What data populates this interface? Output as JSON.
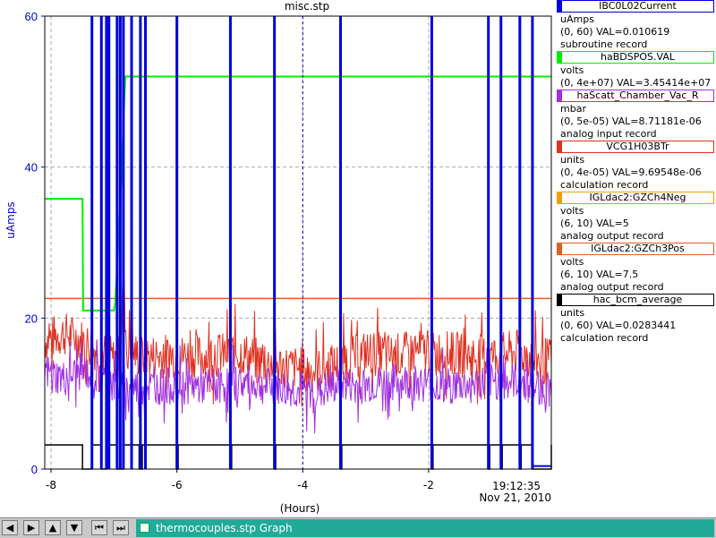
{
  "chart_data": {
    "type": "line",
    "title": "misc.stp",
    "xlabel": "(Hours)",
    "ylabel": "uAmps",
    "xlim": [
      -8.1,
      -0.05
    ],
    "ylim": [
      0,
      60
    ],
    "x_ticks": [
      -8,
      -6,
      -4,
      -2
    ],
    "x_tick_labels": [
      "-8",
      "-6",
      "-4",
      "-2"
    ],
    "y_ticks": [
      0,
      20,
      40,
      60
    ],
    "y_tick_labels": [
      "0",
      "20",
      "40",
      "60"
    ],
    "time_label": "19:12:35",
    "date_label": "Nov 21, 2010",
    "grid": true,
    "colors": {
      "current": "#0000dd",
      "bdspos": "#00ee00",
      "vacuum": "#a030e0",
      "vcg": "#e03020",
      "neg": "#e07000",
      "pos": "#e06020",
      "bcm": "#000000"
    },
    "series": [
      {
        "name": "IBC0L02Current",
        "color": "#0000dd",
        "spike_x": [
          -7.35,
          -7.2,
          -7.12,
          -7.08,
          -6.95,
          -6.9,
          -6.85,
          -6.72,
          -6.58,
          -6.5,
          -6.0,
          -5.15,
          -4.45,
          -3.4,
          -1.95,
          -1.05,
          -0.85,
          -0.55,
          -0.35
        ]
      },
      {
        "name": "haBDSPOS.VAL",
        "color": "#00ee00",
        "x": [
          -8.1,
          -7.5,
          -7.49,
          -7.0,
          -6.98,
          -6.9,
          -6.82,
          -6.8,
          -0.05
        ],
        "y": [
          35.8,
          35.8,
          21,
          21,
          22,
          35,
          52,
          52,
          52
        ]
      },
      {
        "name": "haScatt_Chamber_Vac_R",
        "color": "#a030e0",
        "x": [
          -8.1,
          -7.8,
          -7.5,
          -7.2,
          -7.0,
          -6.85,
          -6.6,
          -6.2,
          -5.8,
          -5.4,
          -5.0,
          -4.6,
          -4.2,
          -3.8,
          -3.4,
          -3.0,
          -2.6,
          -2.2,
          -1.8,
          -1.4,
          -1.0,
          -0.6,
          -0.3,
          -0.05
        ],
        "y": [
          13,
          12,
          13,
          12,
          11,
          10.5,
          11,
          11,
          11,
          11,
          11.5,
          11,
          10.5,
          10,
          11,
          11,
          11.5,
          11.5,
          11,
          11,
          11.5,
          11.5,
          11,
          10.5
        ]
      },
      {
        "name": "VCG1H03BTr",
        "color": "#e03020",
        "x": [
          -8.1,
          -7.8,
          -7.5,
          -7.2,
          -7.0,
          -6.9,
          -6.85,
          -6.8,
          -6.6,
          -6.2,
          -5.8,
          -5.4,
          -5.0,
          -4.6,
          -4.2,
          -3.8,
          -3.4,
          -3.0,
          -2.6,
          -2.2,
          -1.8,
          -1.4,
          -1.0,
          -0.6,
          -0.3,
          -0.05
        ],
        "y": [
          17,
          18,
          17,
          15.5,
          14.5,
          15,
          26,
          16,
          15,
          15,
          15,
          15,
          15.5,
          14,
          13.5,
          13,
          14,
          15.5,
          15,
          15.5,
          15.5,
          15,
          15,
          15.5,
          14.5,
          14.5
        ]
      },
      {
        "name": "IGLdac2:GZCh4Neg",
        "color": "#e07000",
        "x": [
          -8.1,
          -0.05
        ],
        "y": [
          22.6,
          22.6
        ]
      },
      {
        "name": "IGLdac2:GZCh3Pos",
        "color": "#e06020",
        "x": [
          -8.1,
          -0.05
        ],
        "y": [
          22.6,
          22.6
        ]
      },
      {
        "name": "hac_bcm_average",
        "color": "#000000",
        "base": 3.2,
        "drops": [
          [
            -7.5,
            -7.35
          ],
          [
            -7.2,
            -7.12
          ],
          [
            -6.95,
            -6.85
          ],
          [
            -6.6,
            -6.55
          ],
          [
            -6.0,
            -5.98
          ],
          [
            -5.15,
            -5.13
          ],
          [
            -4.45,
            -4.43
          ],
          [
            -3.4,
            -3.38
          ],
          [
            -1.95,
            -1.93
          ],
          [
            -1.05,
            -1.03
          ],
          [
            -0.85,
            -0.83
          ],
          [
            -0.55,
            -0.53
          ],
          [
            -0.35,
            -0.05
          ]
        ]
      }
    ]
  },
  "legend": [
    {
      "name": "IBC0L02Current",
      "color": "#0000dd",
      "unit": "uAmps",
      "range": "(0, 60) VAL=0.010619",
      "rtype": "subroutine record"
    },
    {
      "name": "haBDSPOS.VAL",
      "color": "#00ee00",
      "unit": "volts",
      "range": "(0, 4e+07) VAL=3.45414e+07",
      "rtype": ""
    },
    {
      "name": "haScatt_Chamber_Vac_R",
      "color": "#a030e0",
      "unit": "mbar",
      "range": "(0, 5e-05) VAL=8.71181e-06",
      "rtype": "analog input record"
    },
    {
      "name": "VCG1H03BTr",
      "color": "#e03020",
      "unit": "units",
      "range": "(0, 4e-05) VAL=9.69548e-06",
      "rtype": "calculation record"
    },
    {
      "name": "IGLdac2:GZCh4Neg",
      "color": "#f0a000",
      "unit": "volts",
      "range": "(6, 10) VAL=5",
      "rtype": "analog output record"
    },
    {
      "name": "IGLdac2:GZCh3Pos",
      "color": "#e06020",
      "unit": "volts",
      "range": "(6, 10) VAL=7.5",
      "rtype": "analog output record"
    },
    {
      "name": "hac_bcm_average",
      "color": "#000000",
      "unit": "units",
      "range": "(0, 60) VAL=0.0283441",
      "rtype": "calculation record"
    }
  ],
  "taskbar": {
    "buttons": [
      "◀",
      "▶",
      "▲",
      "▼",
      "⏮",
      "⏭"
    ],
    "task_label": "thermocouples.stp  Graph"
  }
}
